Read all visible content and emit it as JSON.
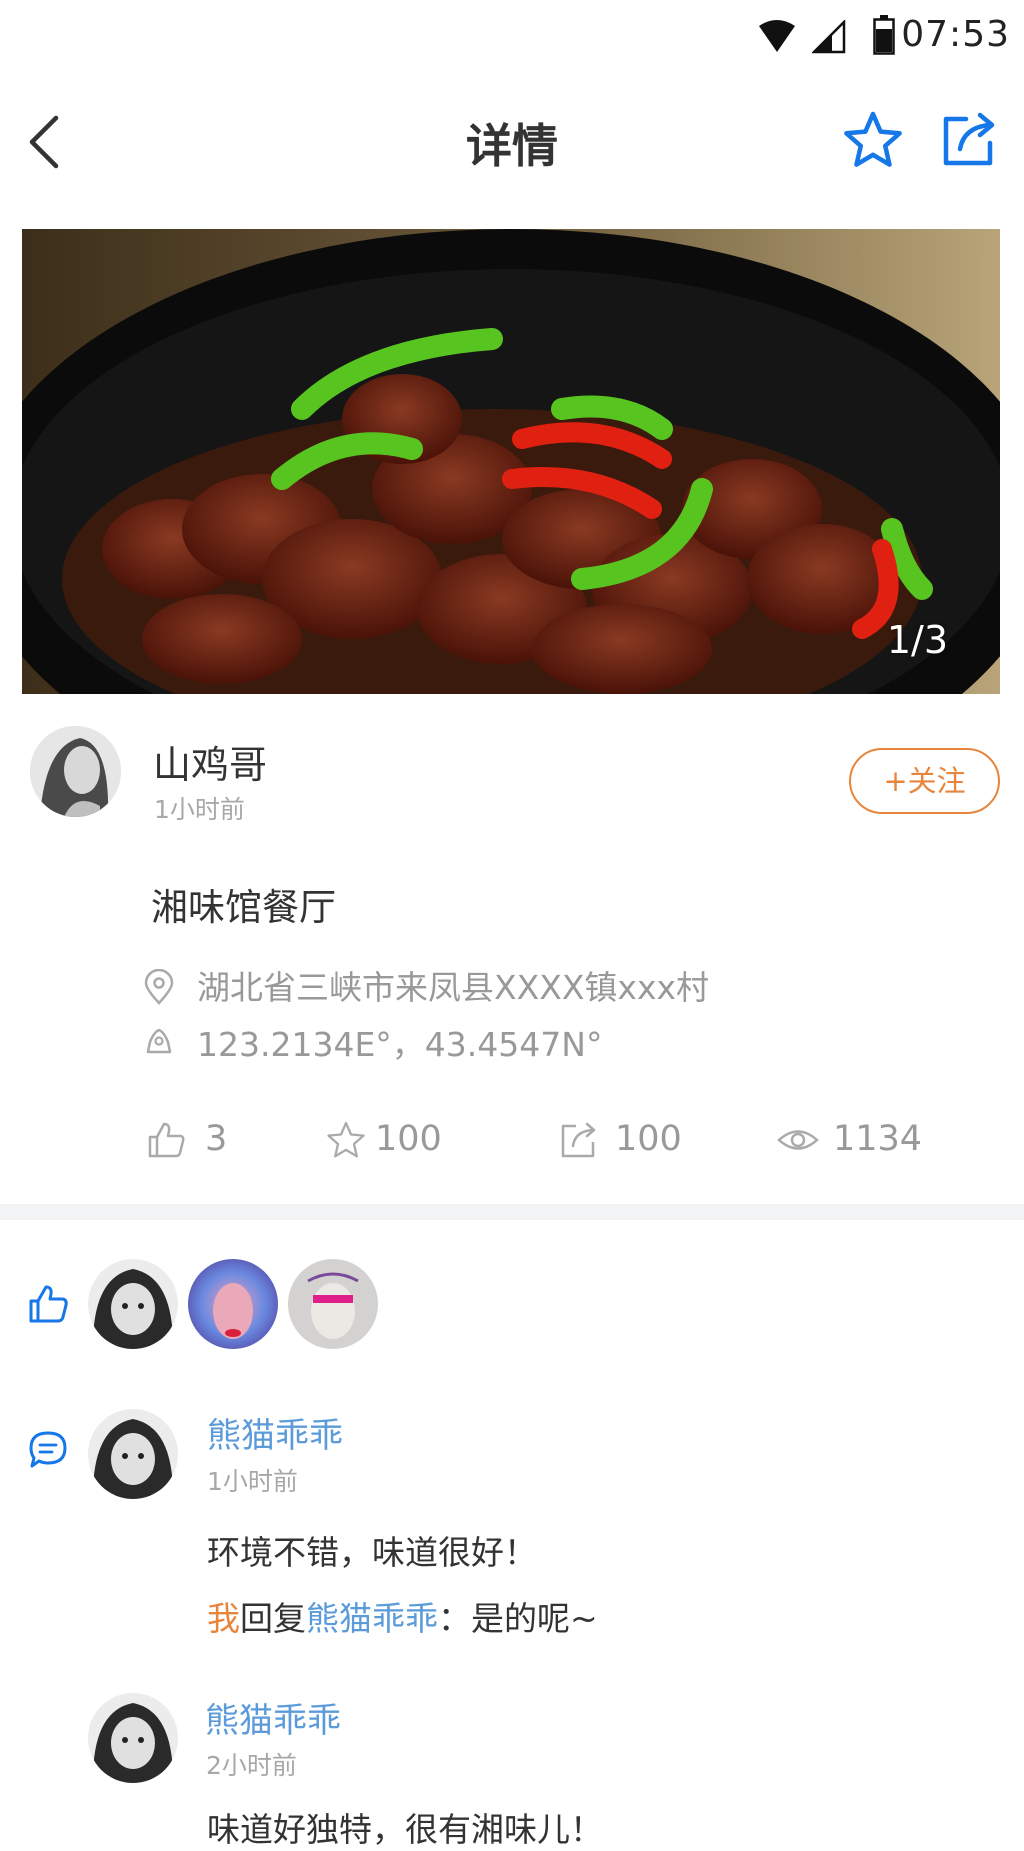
{
  "status_bar": {
    "time": "07:53"
  },
  "nav": {
    "title": "详情"
  },
  "banner": {
    "page_indicator": "1/3"
  },
  "author": {
    "name": "山鸡哥",
    "time": "1小时前",
    "follow_label": "+关注"
  },
  "post": {
    "restaurant": "湘味馆餐厅",
    "address": "湖北省三峡市来凤县XXXX镇xxx村",
    "coordinates": "123.2134E°，43.4547N°"
  },
  "stats": {
    "likes": "3",
    "favorites": "100",
    "shares": "100",
    "views": "1134"
  },
  "comments": [
    {
      "name": "熊猫乖乖",
      "time": "1小时前",
      "text": "环境不错，味道很好！",
      "reply": {
        "from": "我",
        "verb": "回复",
        "to": "熊猫乖乖",
        "text": "：是的呢~"
      }
    },
    {
      "name": "熊猫乖乖",
      "time": "2小时前",
      "text": "味道好独特，很有湘味儿！"
    }
  ],
  "colors": {
    "accent_blue": "#1677e8",
    "follow_orange": "#e8853c",
    "name_blue": "#5b9bd9"
  }
}
